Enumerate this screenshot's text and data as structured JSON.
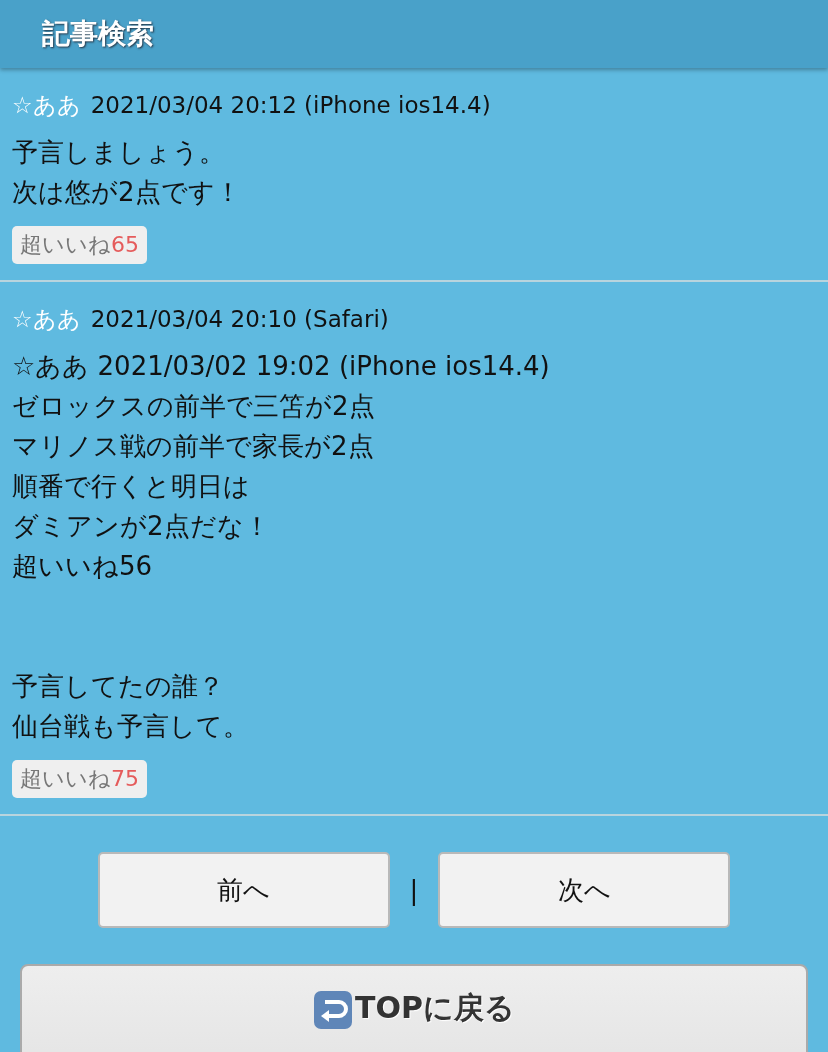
{
  "header": {
    "title": "記事検索"
  },
  "posts": [
    {
      "author": "☆ああ",
      "meta": "2021/03/04 20:12 (iPhone ios14.4)",
      "paragraphs": [
        [
          "予言しましょう。",
          "次は悠が2点です！"
        ]
      ],
      "like": {
        "label": "超いいね",
        "count": "65"
      }
    },
    {
      "author": "☆ああ",
      "meta": "2021/03/04 20:10 (Safari)",
      "paragraphs": [
        [
          "☆ああ 2021/03/02 19:02 (iPhone ios14.4)",
          "ゼロックスの前半で三笘が2点",
          "マリノス戦の前半で家長が2点",
          "順番で行くと明日は",
          "ダミアンが2点だな！",
          "超いいね56"
        ],
        [
          "予言してたの誰？",
          "仙台戦も予言して。"
        ]
      ],
      "like": {
        "label": "超いいね",
        "count": "75"
      }
    }
  ],
  "pager": {
    "prev": "前へ",
    "separator": "|",
    "next": "次へ"
  },
  "top_button": {
    "label": "TOPに戻る"
  }
}
